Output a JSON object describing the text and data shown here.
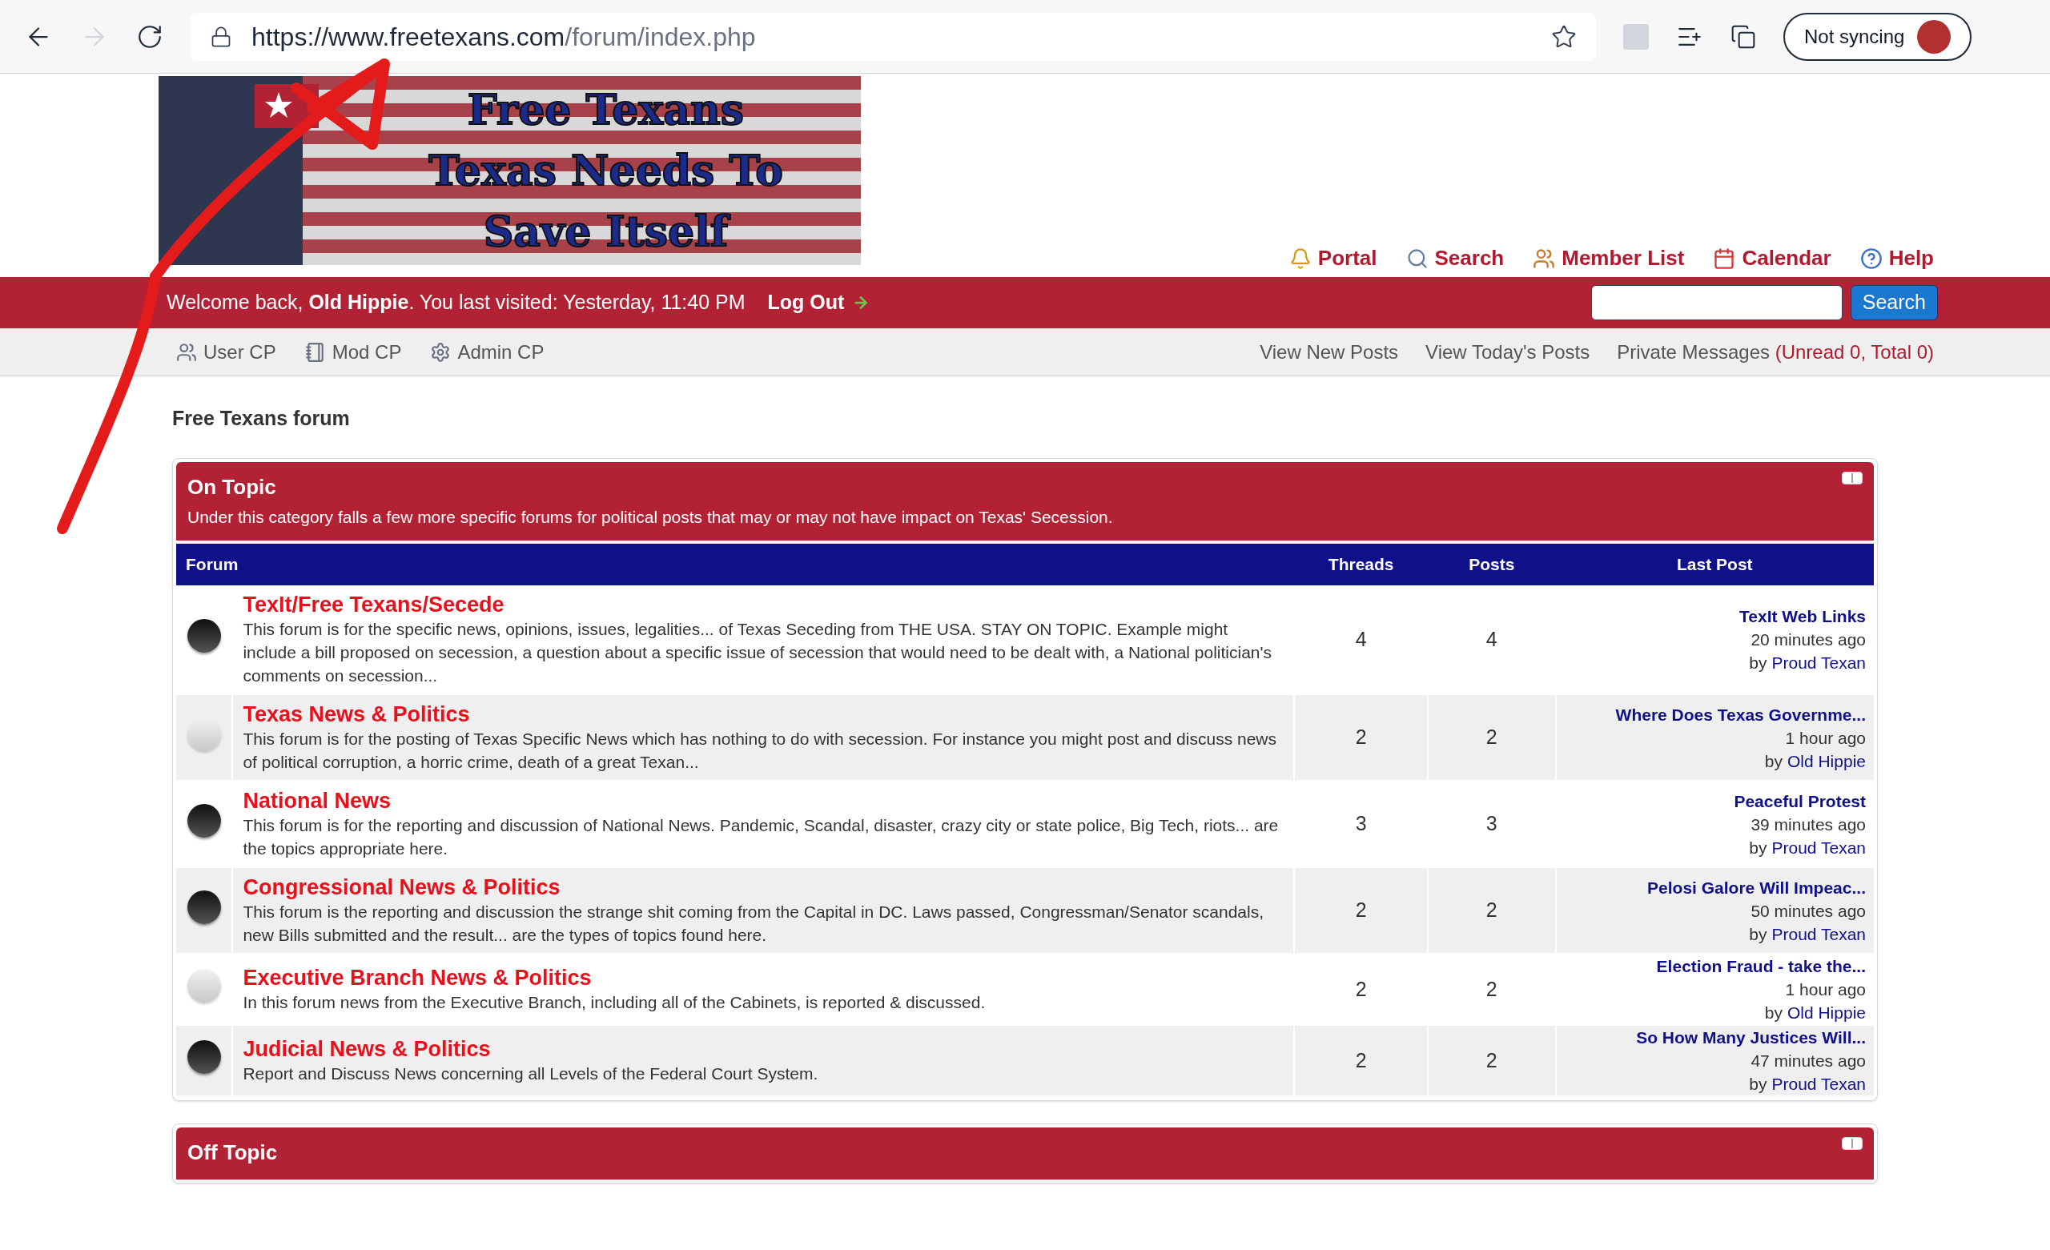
{
  "browser": {
    "url_host": "https://www.freetexans.com",
    "url_path": "/forum/index.php",
    "sync": "Not syncing"
  },
  "banner": {
    "lines": [
      "Free Texans",
      "Texas Needs To",
      "Save Itself"
    ]
  },
  "top_links": [
    "Portal",
    "Search",
    "Member List",
    "Calendar",
    "Help"
  ],
  "welcome": {
    "greeting": "Welcome back, **Old Hippie**. You last visited: Yesterday, 11:40 PM",
    "logout": "Log Out",
    "search_button": "Search"
  },
  "panel_links": [
    "User CP",
    "Mod CP",
    "Admin CP"
  ],
  "quick_links": [
    "View New Posts",
    "View Today's Posts"
  ],
  "private_messages": {
    "label": "Private Messages",
    "counts": "(Unread 0, Total 0)"
  },
  "board_title": "Free Texans forum",
  "categories": [
    {
      "title": "On Topic",
      "description": "Under this category falls a few more specific forums for political posts that may or may not have impact on Texas' Secession.",
      "columns": [
        "Forum",
        "Threads",
        "Posts",
        "Last Post"
      ],
      "forums": [
        {
          "name": "TexIt/Free Texans/Secede",
          "description": "This forum is for the specific news, opinions, issues, legalities... of Texas Seceding from THE USA. STAY ON TOPIC. Example might include a bill proposed on secession, a question about a specific issue of secession that would need to be dealt with, a National politician's comments on secession...",
          "unread": true,
          "threads": "4",
          "posts": "4",
          "last_post": {
            "title": "TexIt Web Links",
            "time": "20 minutes ago",
            "by": "by",
            "user": "Proud Texan"
          }
        },
        {
          "name": "Texas News & Politics",
          "description": "This forum is for the posting of Texas Specific News which has nothing to do with secession. For instance you might post and discuss news of political corruption, a horric crime, death of a great Texan...",
          "unread": false,
          "threads": "2",
          "posts": "2",
          "last_post": {
            "title": "Where Does Texas Governme...",
            "time": "1 hour ago",
            "by": "by",
            "user": "Old Hippie"
          }
        },
        {
          "name": "National News",
          "description": "This forum is for the reporting and discussion of National News. Pandemic, Scandal, disaster, crazy city or state police, Big Tech, riots... are the topics appropriate here.",
          "unread": true,
          "threads": "3",
          "posts": "3",
          "last_post": {
            "title": "Peaceful Protest",
            "time": "39 minutes ago",
            "by": "by",
            "user": "Proud Texan"
          }
        },
        {
          "name": "Congressional News & Politics",
          "description": "This forum is the reporting and discussion the strange shit coming from the Capital in DC. Laws passed, Congressman/Senator scandals, new Bills submitted and the result... are the types of topics found here.",
          "unread": true,
          "threads": "2",
          "posts": "2",
          "last_post": {
            "title": "Pelosi Galore Will Impeac...",
            "time": "50 minutes ago",
            "by": "by",
            "user": "Proud Texan"
          }
        },
        {
          "name": "Executive Branch News & Politics",
          "description": "In this forum news from the Executive Branch, including all of the Cabinets, is reported & discussed.",
          "unread": false,
          "threads": "2",
          "posts": "2",
          "last_post": {
            "title": "Election Fraud - take the...",
            "time": "1 hour ago",
            "by": "by",
            "user": "Old Hippie"
          }
        },
        {
          "name": "Judicial News & Politics",
          "description": "Report and Discuss News concerning all Levels of the Federal Court System.",
          "unread": true,
          "threads": "2",
          "posts": "2",
          "last_post": {
            "title": "So How Many Justices Will...",
            "time": "47 minutes ago",
            "by": "by",
            "user": "Proud Texan"
          }
        }
      ]
    },
    {
      "title": "Off Topic"
    }
  ]
}
